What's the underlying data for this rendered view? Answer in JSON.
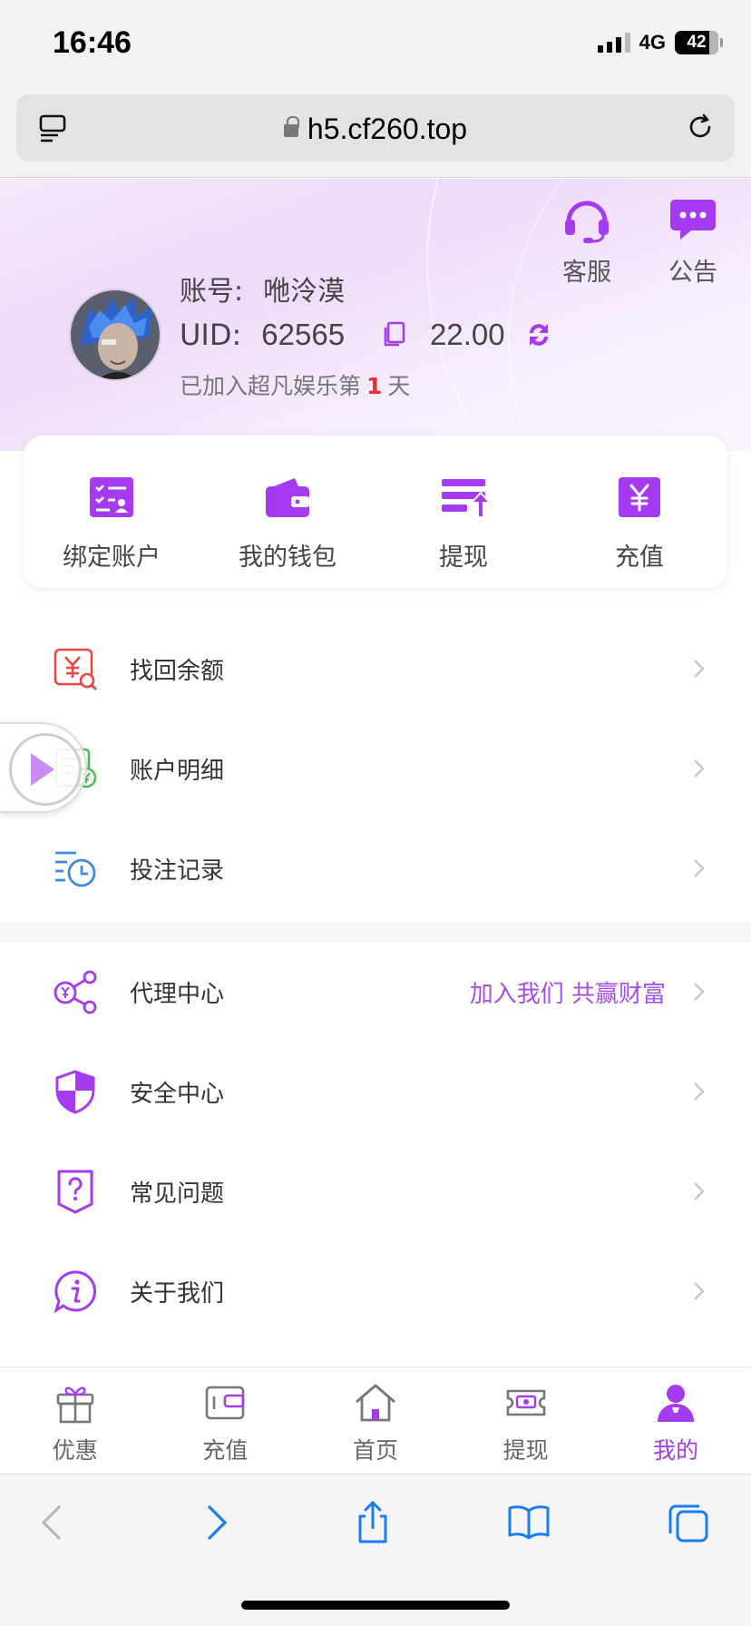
{
  "status_bar": {
    "time": "16:46",
    "network": "4G",
    "battery": "42"
  },
  "browser": {
    "url": "h5.cf260.top"
  },
  "header": {
    "service_label": "客服",
    "notice_label": "公告",
    "account_label": "账号:",
    "account_value": "咃泠漠",
    "uid_label": "UID:",
    "uid_value": "62565",
    "balance": "22.00",
    "days_prefix": "已加入超凡娱乐第",
    "days_count": "1",
    "days_suffix": "天"
  },
  "quick_actions": [
    {
      "label": "绑定账户",
      "icon": "bind-account-icon"
    },
    {
      "label": "我的钱包",
      "icon": "wallet-icon"
    },
    {
      "label": "提现",
      "icon": "withdraw-icon"
    },
    {
      "label": "充值",
      "icon": "recharge-icon"
    }
  ],
  "menu": {
    "group1": [
      {
        "label": "找回余额",
        "icon": "recover-balance-icon"
      },
      {
        "label": "账户明细",
        "icon": "account-details-icon"
      },
      {
        "label": "投注记录",
        "icon": "bet-record-icon"
      }
    ],
    "group2": [
      {
        "label": "代理中心",
        "icon": "agent-icon",
        "extra": "加入我们 共赢财富"
      },
      {
        "label": "安全中心",
        "icon": "shield-icon"
      },
      {
        "label": "常见问题",
        "icon": "faq-icon"
      },
      {
        "label": "关于我们",
        "icon": "info-icon"
      }
    ]
  },
  "tabbar": [
    {
      "label": "优惠",
      "icon": "gift-icon",
      "active": false
    },
    {
      "label": "充值",
      "icon": "wallet-tab-icon",
      "active": false
    },
    {
      "label": "首页",
      "icon": "home-icon",
      "active": false
    },
    {
      "label": "提现",
      "icon": "ticket-icon",
      "active": false
    },
    {
      "label": "我的",
      "icon": "user-icon",
      "active": true
    }
  ],
  "colors": {
    "accent": "#a53bf0",
    "highlight_red": "#e8312a"
  }
}
